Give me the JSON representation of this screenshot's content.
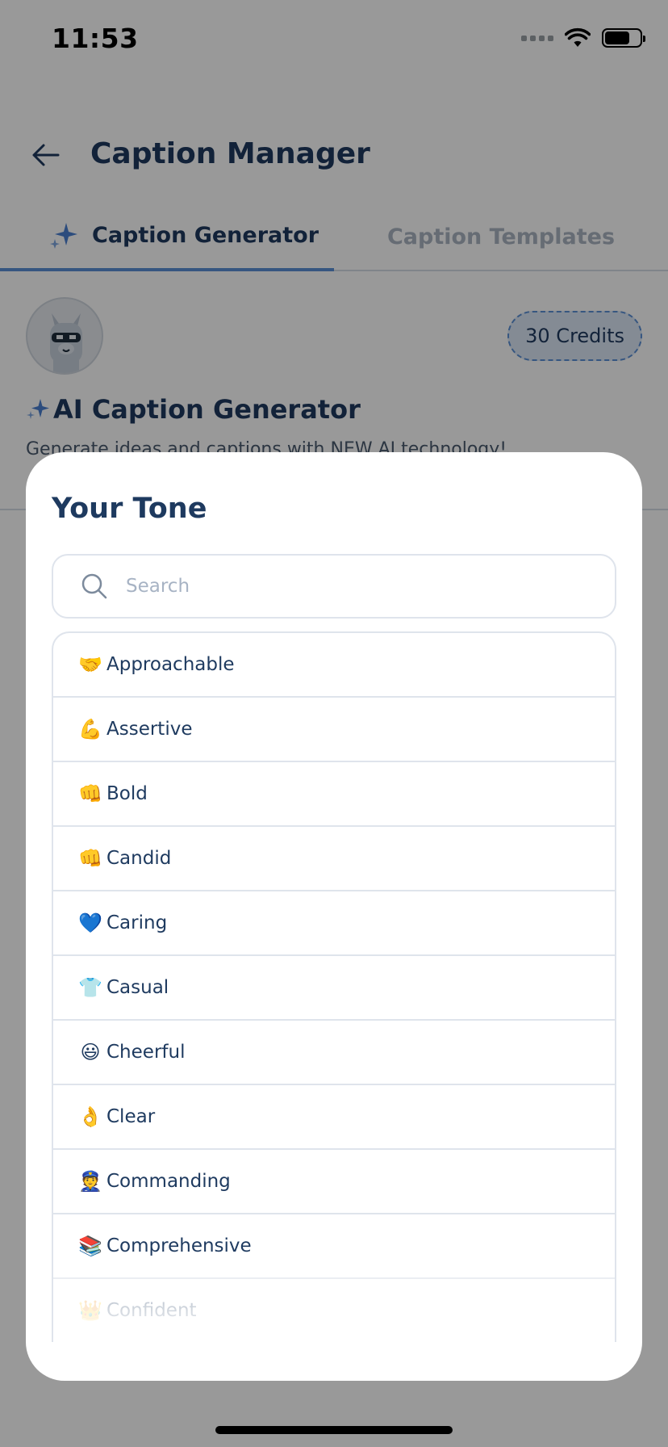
{
  "status_bar": {
    "time": "11:53"
  },
  "header": {
    "title": "Caption Manager"
  },
  "tabs": [
    {
      "label": "Caption Generator",
      "active": true
    },
    {
      "label": "Caption Templates",
      "active": false
    }
  ],
  "credits": "30 Credits",
  "generator": {
    "title": "AI Caption Generator",
    "description": "Generate ideas and captions with NEW AI technology!"
  },
  "modal": {
    "title": "Your Tone",
    "search_placeholder": "Search",
    "items": [
      {
        "emoji": "🤝",
        "label": "Approachable"
      },
      {
        "emoji": "💪",
        "label": "Assertive"
      },
      {
        "emoji": "👊",
        "label": "Bold"
      },
      {
        "emoji": "👊",
        "label": "Candid"
      },
      {
        "emoji": "💙",
        "label": "Caring"
      },
      {
        "emoji": "👕",
        "label": "Casual"
      },
      {
        "emoji": "😃",
        "label": "Cheerful"
      },
      {
        "emoji": "👌",
        "label": "Clear"
      },
      {
        "emoji": "👮",
        "label": "Commanding"
      },
      {
        "emoji": "📚",
        "label": "Comprehensive"
      },
      {
        "emoji": "👑",
        "label": "Confident"
      }
    ]
  },
  "colors": {
    "text_primary": "#1e3a5f",
    "accent": "#5b8fd6",
    "muted": "#aab4c2",
    "border": "#dfe4ec"
  }
}
